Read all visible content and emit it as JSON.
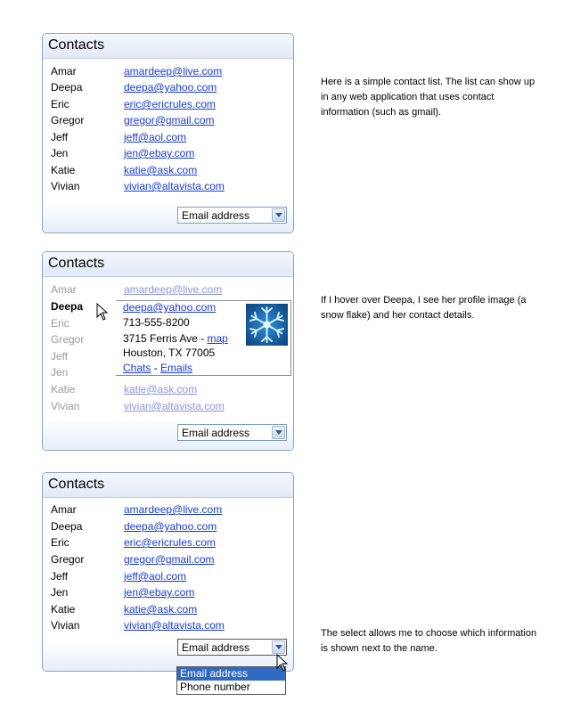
{
  "panels": [
    {
      "title": "Contacts",
      "contacts": [
        {
          "name": "Amar",
          "email": "amardeep@live.com"
        },
        {
          "name": "Deepa",
          "email": "deepa@yahoo.com"
        },
        {
          "name": "Eric",
          "email": "eric@ericrules.com"
        },
        {
          "name": "Gregor",
          "email": "gregor@gmail.com"
        },
        {
          "name": "Jeff",
          "email": "jeff@aol.com"
        },
        {
          "name": "Jen",
          "email": "jen@ebay.com"
        },
        {
          "name": "Katie",
          "email": "katie@ask.com"
        },
        {
          "name": "Vivian",
          "email": "vivian@altavista.com"
        }
      ],
      "select_value": "Email address",
      "caption": "Here is a simple contact list. The list can show up in any web application that uses contact information (such as gmail)."
    },
    {
      "title": "Contacts",
      "contacts": [
        {
          "name": "Amar",
          "email": "amardeep@live.com"
        },
        {
          "name": "Deepa",
          "email": "deepa@yahoo.com"
        },
        {
          "name": "Eric",
          "email": ""
        },
        {
          "name": "Gregor",
          "email": ""
        },
        {
          "name": "Jeff",
          "email": ""
        },
        {
          "name": "Jen",
          "email": ""
        },
        {
          "name": "Katie",
          "email": "katie@ask.com"
        },
        {
          "name": "Vivian",
          "email": "vivian@altavista.com"
        }
      ],
      "hover_card": {
        "email": "deepa@yahoo.com",
        "phone": "713-555-8200",
        "address_line1": "3715 Ferris Ave",
        "address_sep": " - ",
        "map_link": "map",
        "address_line2": "Houston, TX 77005",
        "chats_link": "Chats",
        "links_sep": " - ",
        "emails_link": "Emails",
        "image_icon": "snowflake-profile-image"
      },
      "select_value": "Email address",
      "caption": "If I hover over Deepa, I see her profile image (a snow flake) and her contact details."
    },
    {
      "title": "Contacts",
      "contacts": [
        {
          "name": "Amar",
          "email": "amardeep@live.com"
        },
        {
          "name": "Deepa",
          "email": "deepa@yahoo.com"
        },
        {
          "name": "Eric",
          "email": "eric@ericrules.com"
        },
        {
          "name": "Gregor",
          "email": "gregor@gmail.com"
        },
        {
          "name": "Jeff",
          "email": "jeff@aol.com"
        },
        {
          "name": "Jen",
          "email": "jen@ebay.com"
        },
        {
          "name": "Katie",
          "email": "katie@ask.com"
        },
        {
          "name": "Vivian",
          "email": "vivian@altavista.com"
        }
      ],
      "select_value": "Email address",
      "dropdown_options": [
        "Email address",
        "Phone number"
      ],
      "dropdown_selected": "Email address",
      "caption": "The select allows me to choose which information is shown next to the name."
    }
  ],
  "colors": {
    "link": "#1a3bd6",
    "border": "#8aa3c9",
    "selected": "#316ac5"
  }
}
